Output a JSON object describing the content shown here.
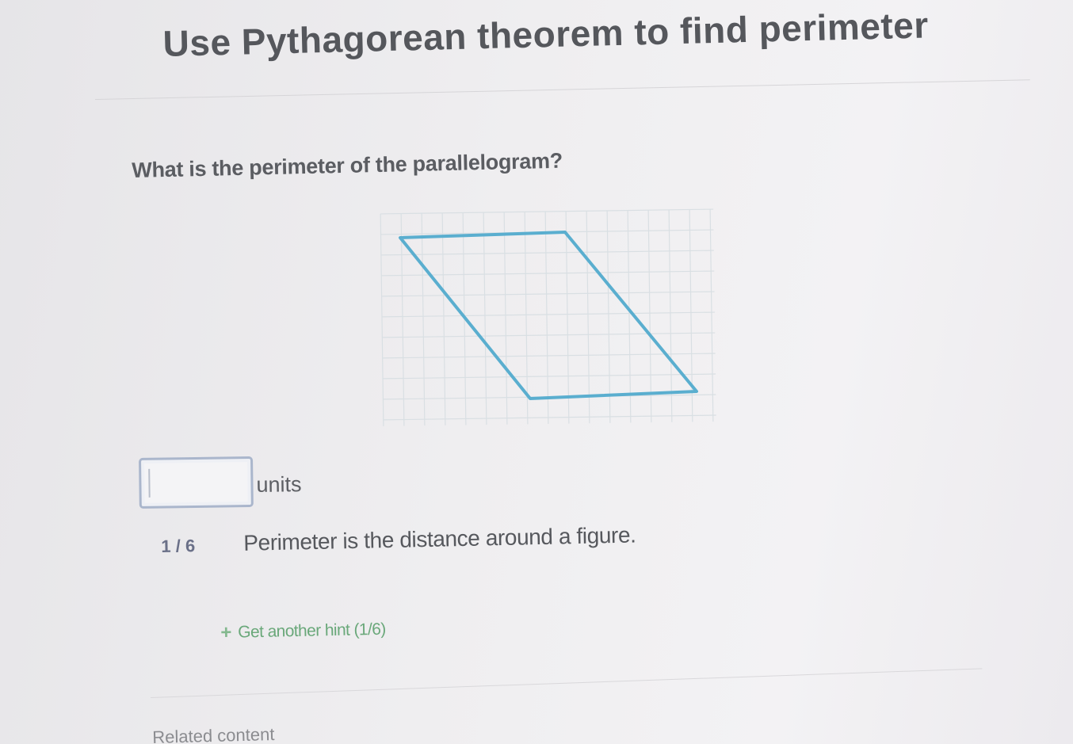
{
  "header": {
    "title": "Use Pythagorean theorem to find perimeter"
  },
  "exercise": {
    "question": "What is the perimeter of the parallelogram?",
    "answer": {
      "value": "",
      "units_label": "units"
    }
  },
  "hints": {
    "counter": "1 / 6",
    "current_hint": "Perimeter is the distance around a figure.",
    "get_another_label": "Get another hint (1/6)",
    "plus_icon": "+"
  },
  "footer": {
    "related_content_label": "Related content"
  },
  "colors": {
    "shape_stroke": "#5aaecf",
    "grid_line": "#d9dfe3",
    "hint_link": "#6aa87a"
  },
  "figure": {
    "shape": "parallelogram",
    "grid_visible": true
  }
}
